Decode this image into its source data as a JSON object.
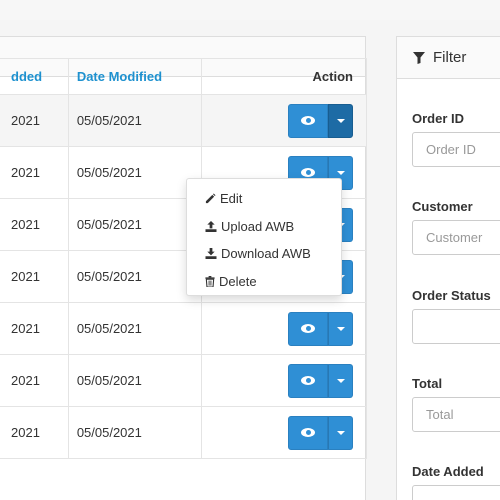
{
  "table": {
    "headers": {
      "date_added": "Date Added",
      "date_added_visible": "dded",
      "date_modified": "Date Modified",
      "action": "Action"
    },
    "rows": [
      {
        "date_added": "2021",
        "date_modified": "05/05/2021"
      },
      {
        "date_added": "2021",
        "date_modified": "05/05/2021"
      },
      {
        "date_added": "2021",
        "date_modified": "05/05/2021"
      },
      {
        "date_added": "2021",
        "date_modified": "05/05/2021"
      },
      {
        "date_added": "2021",
        "date_modified": "05/05/2021"
      },
      {
        "date_added": "2021",
        "date_modified": "05/05/2021"
      },
      {
        "date_added": "2021",
        "date_modified": "05/05/2021"
      }
    ]
  },
  "dropdown": {
    "items": [
      {
        "label": "Edit",
        "icon": "pencil-icon"
      },
      {
        "label": "Upload AWB",
        "icon": "upload-icon"
      },
      {
        "label": "Download AWB",
        "icon": "download-icon"
      },
      {
        "label": "Delete",
        "icon": "trash-icon"
      }
    ]
  },
  "filter": {
    "title": "Filter",
    "fields": [
      {
        "label": "Order ID",
        "placeholder": "Order ID"
      },
      {
        "label": "Customer",
        "placeholder": "Customer"
      },
      {
        "label": "Order Status",
        "placeholder": ""
      },
      {
        "label": "Total",
        "placeholder": "Total"
      },
      {
        "label": "Date Added",
        "placeholder": ""
      }
    ]
  },
  "colors": {
    "primary": "#2f8fd5",
    "primary_active": "#1d6ba5",
    "link": "#1e91cf",
    "border": "#dddddd"
  }
}
